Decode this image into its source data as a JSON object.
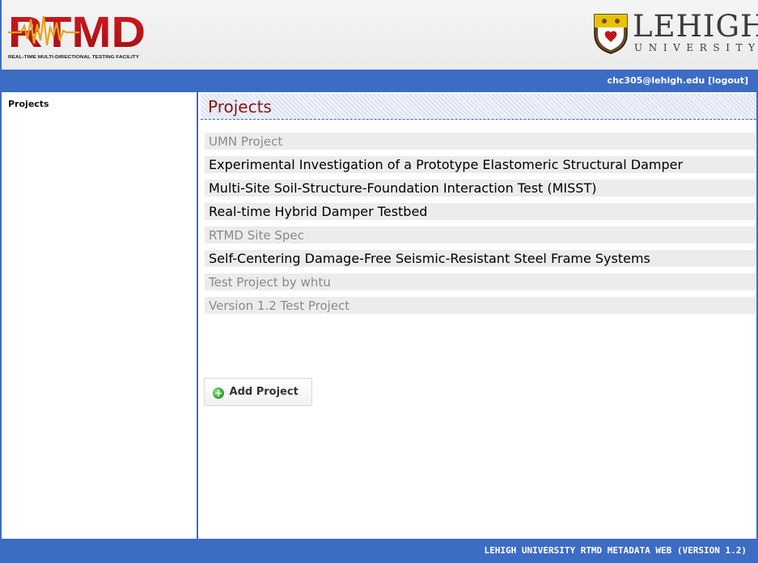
{
  "header": {
    "rtmd_logo_text": "RTMD",
    "rtmd_logo_subtext": "REAL-TIME MULTI-DIRECTIONAL TESTING FACILITY",
    "university_name": "LEHIGH",
    "university_sub": "UNIVERSITY"
  },
  "userbar": {
    "user_text": "chc305@lehigh.edu [logout]"
  },
  "sidebar": {
    "items": [
      {
        "label": "Projects"
      }
    ]
  },
  "main": {
    "title": "Projects",
    "projects": [
      {
        "label": "UMN Project",
        "state": "inactive"
      },
      {
        "label": "Experimental Investigation of a Prototype Elastomeric Structural Damper",
        "state": "active"
      },
      {
        "label": "Multi-Site Soil-Structure-Foundation Interaction Test (MISST)",
        "state": "active"
      },
      {
        "label": "Real-time Hybrid Damper Testbed",
        "state": "active"
      },
      {
        "label": "RTMD Site Spec",
        "state": "inactive"
      },
      {
        "label": "Self-Centering Damage-Free Seismic-Resistant Steel Frame Systems",
        "state": "active"
      },
      {
        "label": "Test Project by whtu",
        "state": "inactive"
      },
      {
        "label": "Version 1.2 Test Project",
        "state": "inactive"
      }
    ],
    "add_button_label": "Add Project",
    "add_button_icon": "plus-circle-icon"
  },
  "footer": {
    "text": "LEHIGH UNIVERSITY RTMD METADATA WEB (VERSION 1.2)"
  },
  "colors": {
    "accent_blue": "#3d6cc4",
    "title_red": "#8b1414",
    "logo_red": "#c0151b",
    "logo_gold": "#e8a317",
    "inactive_text": "#8a8a8a",
    "row_background": "#ececec"
  }
}
